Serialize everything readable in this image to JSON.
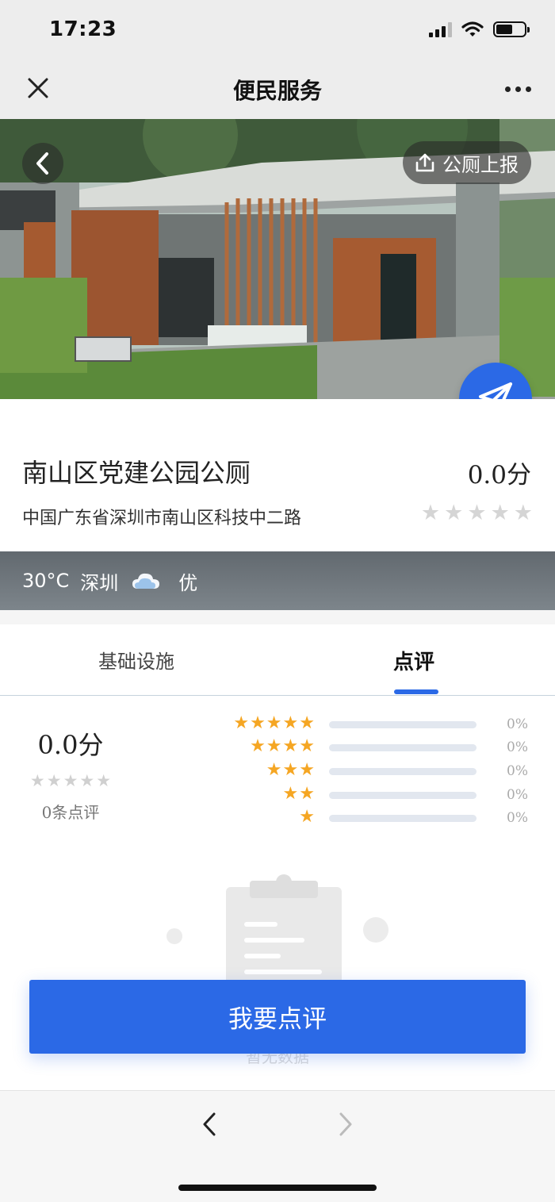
{
  "status_bar": {
    "time": "17:23"
  },
  "nav": {
    "title": "便民服务"
  },
  "hero": {
    "report_label": "公厕上报"
  },
  "place": {
    "name": "南山区党建公园公厕",
    "score": "0.0分",
    "address": "中国广东省深圳市南山区科技中二路",
    "stars_filled": 0,
    "stars_total": 5
  },
  "weather": {
    "temperature": "30°C",
    "city": "深圳",
    "condition_icon": "cloud-icon",
    "air_quality": "优"
  },
  "tabs": [
    {
      "label": "基础设施",
      "active": false
    },
    {
      "label": "点评",
      "active": true
    }
  ],
  "rating_summary": {
    "score": "0.0分",
    "count_label": "0条点评",
    "distribution": [
      {
        "stars": 5,
        "percent_label": "0%",
        "fraction": 0
      },
      {
        "stars": 4,
        "percent_label": "0%",
        "fraction": 0
      },
      {
        "stars": 3,
        "percent_label": "0%",
        "fraction": 0
      },
      {
        "stars": 2,
        "percent_label": "0%",
        "fraction": 0
      },
      {
        "stars": 1,
        "percent_label": "0%",
        "fraction": 0
      }
    ]
  },
  "empty_state": {
    "text": "暂无数据"
  },
  "cta": {
    "label": "我要点评"
  },
  "colors": {
    "accent": "#2b69e6",
    "star_active": "#f5a623",
    "star_inactive": "#d5d5d5"
  }
}
